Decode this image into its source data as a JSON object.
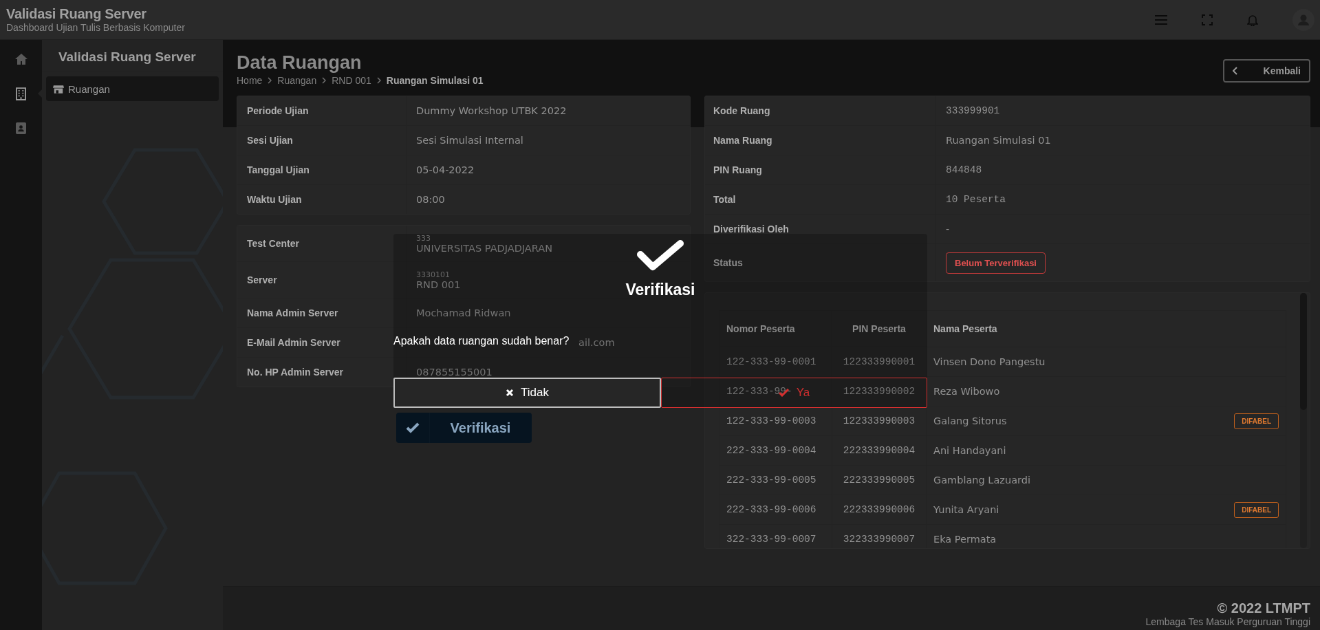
{
  "header": {
    "title": "Validasi Ruang Server",
    "subtitle": "Dashboard Ujian Tulis Berbasis Komputer"
  },
  "icon_rail": [
    {
      "kind": "home",
      "selected": false
    },
    {
      "kind": "building",
      "selected": true
    },
    {
      "kind": "contact",
      "selected": false
    }
  ],
  "sidebar": {
    "title": "Validasi Ruang Server",
    "items": [
      {
        "label": "Ruangan",
        "selected": true
      }
    ]
  },
  "page": {
    "title": "Data Ruangan",
    "breadcrumb": [
      "Home",
      "Ruangan",
      "RND 001",
      "Ruangan Simulasi 01"
    ],
    "back_button": "Kembali"
  },
  "exam_info": [
    {
      "label": "Periode Ujian",
      "value": "Dummy Workshop UTBK 2022"
    },
    {
      "label": "Sesi Ujian",
      "value": "Sesi Simulasi Internal"
    },
    {
      "label": "Tanggal Ujian",
      "value": "05-04-2022"
    },
    {
      "label": "Waktu Ujian",
      "value": "08:00"
    }
  ],
  "server_info": [
    {
      "label": "Test Center",
      "code": "333",
      "value": "UNIVERSITAS PADJADJARAN"
    },
    {
      "label": "Server",
      "code": "3330101",
      "value": "RND 001"
    },
    {
      "label": "Nama Admin Server",
      "value": "Mochamad Ridwan"
    },
    {
      "label": "E-Mail Admin Server",
      "value": "ail.com",
      "kind": "partial"
    },
    {
      "label": "No. HP Admin Server",
      "value": "087855155001"
    }
  ],
  "verify_button": "Verifikasi",
  "room_info": [
    {
      "label": "Kode Ruang",
      "value": "333999901",
      "kind": "mono"
    },
    {
      "label": "Nama Ruang",
      "value": "Ruangan Simulasi 01",
      "kind": "text"
    },
    {
      "label": "PIN Ruang",
      "value": "844848",
      "kind": "mono"
    },
    {
      "label": "Total",
      "value": "10 Peserta",
      "kind": "mono"
    },
    {
      "label": "Diverifikasi Oleh",
      "value": "-",
      "kind": "text"
    },
    {
      "label": "Status",
      "value": "Belum Terverifikasi",
      "kind": "badge"
    }
  ],
  "participants": {
    "columns": [
      "Nomor Peserta",
      "PIN Peserta",
      "Nama Peserta"
    ],
    "rows": [
      {
        "number": "122-333-99-0001",
        "pin": "122333990001",
        "name": "Vinsen Dono Pangestu"
      },
      {
        "number": "122-333-99-",
        "pin": "122333990002",
        "name": "Reza Wibowo"
      },
      {
        "number": "122-333-99-0003",
        "pin": "122333990003",
        "name": "Galang Sitorus",
        "badge": "DIFABEL"
      },
      {
        "number": "222-333-99-0004",
        "pin": "222333990004",
        "name": "Ani Handayani"
      },
      {
        "number": "222-333-99-0005",
        "pin": "222333990005",
        "name": "Gamblang Lazuardi"
      },
      {
        "number": "222-333-99-0006",
        "pin": "222333990006",
        "name": "Yunita Aryani",
        "badge": "DIFABEL"
      },
      {
        "number": "322-333-99-0007",
        "pin": "322333990007",
        "name": "Eka Permata"
      }
    ]
  },
  "footer": {
    "copyright": "© 2022 LTMPT",
    "organization": "Lembaga Tes Masuk Perguruan Tinggi"
  },
  "dialog": {
    "title": "Verifikasi",
    "message": "Apakah data ruangan sudah benar?",
    "buttons": [
      {
        "label": "Tidak",
        "kind": "cancel"
      },
      {
        "label": "Ya",
        "kind": "confirm"
      }
    ]
  }
}
